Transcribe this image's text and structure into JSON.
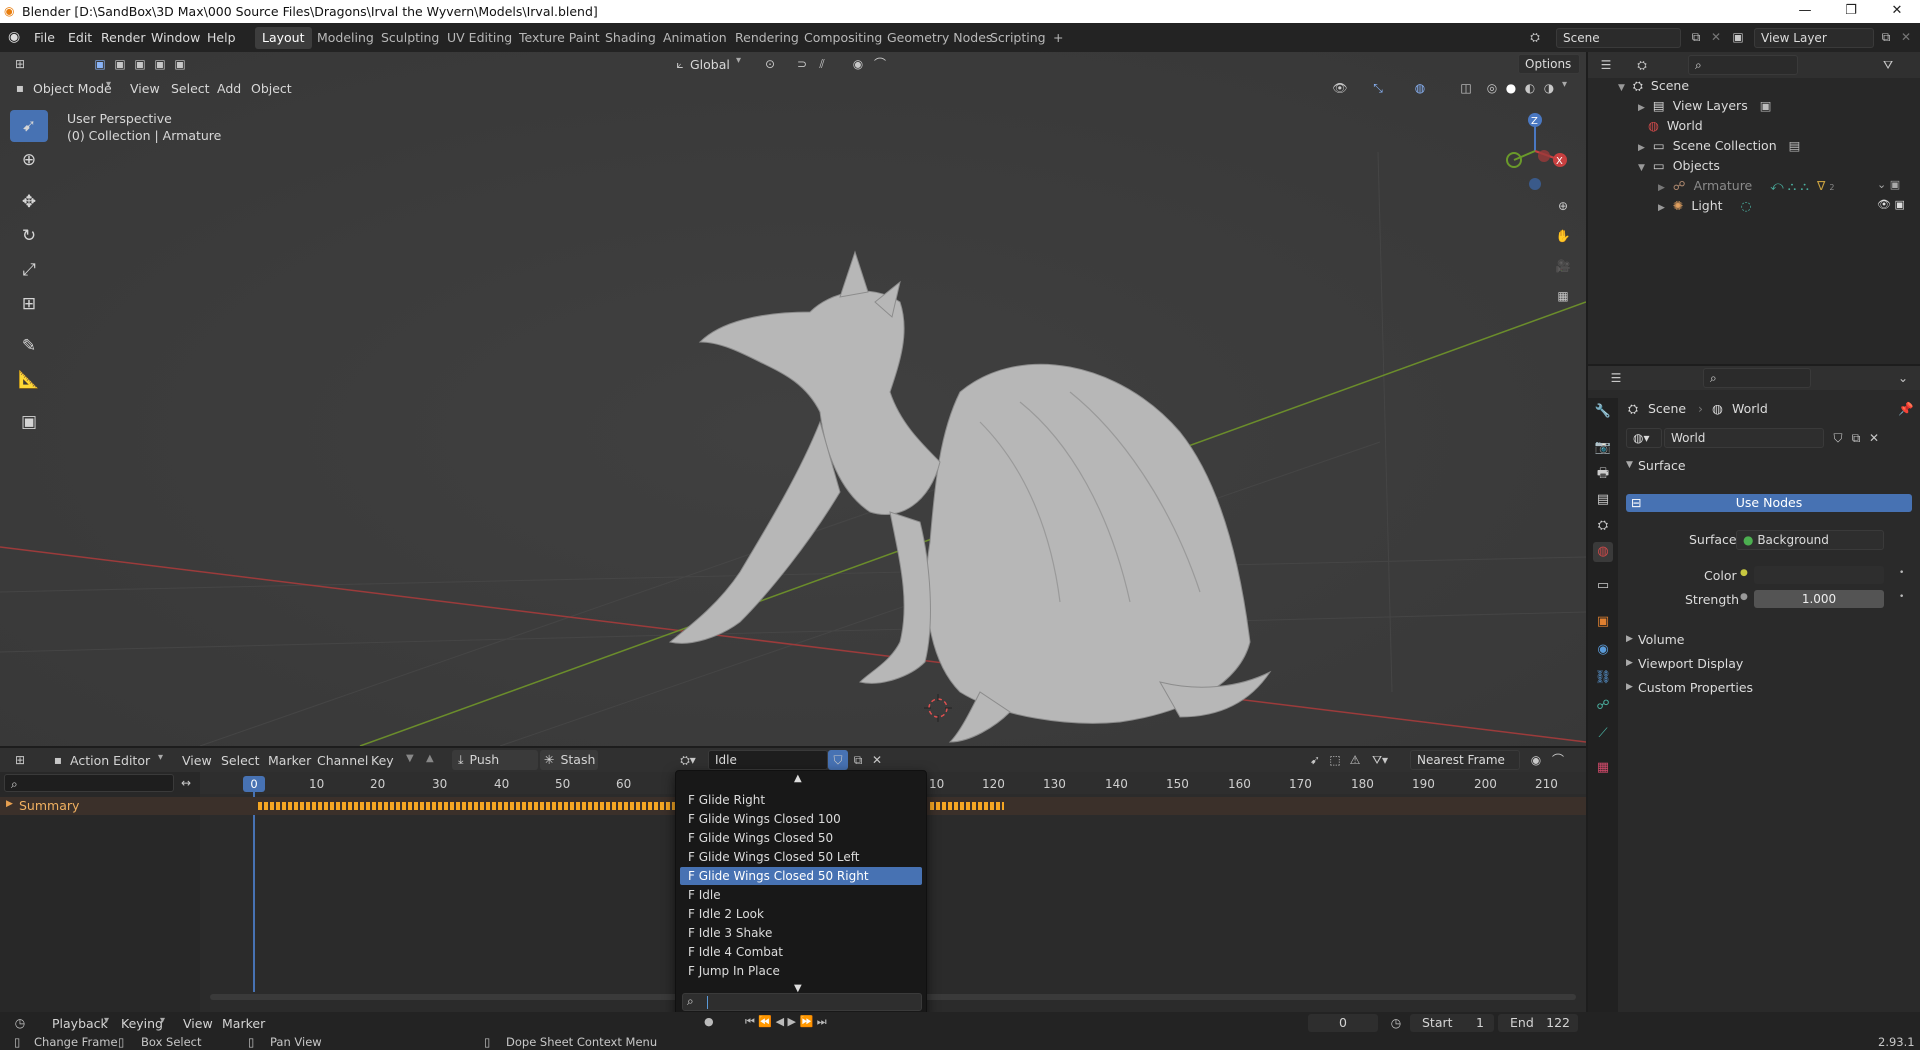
{
  "window": {
    "title": "Blender [D:\\SandBox\\3D Max\\000 Source Files\\Dragons\\Irval the Wyvern\\Models\\Irval.blend]",
    "minimize": "—",
    "maximize": "❐",
    "close": "✕"
  },
  "menubar": {
    "items": [
      "File",
      "Edit",
      "Render",
      "Window",
      "Help"
    ],
    "workspaces": [
      "Layout",
      "Modeling",
      "Sculpting",
      "UV Editing",
      "Texture Paint",
      "Shading",
      "Animation",
      "Rendering",
      "Compositing",
      "Geometry Nodes",
      "Scripting"
    ],
    "add_workspace": "+",
    "scene": "Scene",
    "view_layer": "View Layer"
  },
  "viewport": {
    "mode": "Object Mode",
    "menus": [
      "View",
      "Select",
      "Add",
      "Object"
    ],
    "transform_orientation": "Global",
    "options": "Options",
    "info_line1": "User Perspective",
    "info_line2": "(0) Collection | Armature",
    "gizmo": {
      "z": "Z",
      "x": "X"
    },
    "colors": {
      "background": "#3d3d3d",
      "x_axis": "#a03a3a",
      "y_axis": "#6a8a2a",
      "mesh": "#b5b5b5"
    }
  },
  "outliner": {
    "rows": [
      {
        "label": "Scene",
        "icon": "scene-icon"
      },
      {
        "label": "View Layers",
        "icon": "view-layers-icon"
      },
      {
        "label": "World",
        "icon": "world-icon"
      },
      {
        "label": "Scene Collection",
        "icon": "collection-icon"
      },
      {
        "label": "Objects",
        "icon": "objects-icon"
      },
      {
        "label": "Armature",
        "icon": "armature-icon"
      },
      {
        "label": "Light",
        "icon": "light-icon"
      }
    ],
    "armature_badge": "2"
  },
  "properties": {
    "breadcrumb_scene": "Scene",
    "breadcrumb_world": "World",
    "world_name": "World",
    "surface_panel": "Surface",
    "use_nodes": "Use Nodes",
    "surface_label": "Surface",
    "surface_value": "Background",
    "color_label": "Color",
    "strength_label": "Strength",
    "strength_value": "1.000",
    "volume_panel": "Volume",
    "viewport_display_panel": "Viewport Display",
    "custom_properties_panel": "Custom Properties"
  },
  "action_editor": {
    "editor_type": "Action Editor",
    "menus": [
      "View",
      "Select",
      "Marker",
      "Channel",
      "Key"
    ],
    "push_down": "Push Down",
    "stash": "Stash",
    "action_name": "Idle",
    "snapping": "Nearest Frame",
    "summary": "Summary",
    "current_frame": "0",
    "ticks": [
      "10",
      "20",
      "30",
      "40",
      "50",
      "60",
      "10",
      "120",
      "130",
      "140",
      "150",
      "160",
      "170",
      "180",
      "190",
      "200",
      "210"
    ]
  },
  "dropdown": {
    "items": [
      "F Glide Right",
      "F Glide Wings Closed 100",
      "F Glide Wings Closed 50",
      "F Glide Wings Closed 50 Left",
      "F Glide Wings Closed 50 Right",
      "F Idle",
      "F Idle 2 Look",
      "F Idle 3 Shake",
      "F Idle 4 Combat",
      "F Jump In Place"
    ],
    "selected_index": 4,
    "search_placeholder": ""
  },
  "timeline": {
    "menus": [
      "Playback",
      "Keying",
      "View",
      "Marker"
    ],
    "frame": "0",
    "start_label": "Start",
    "start_value": "1",
    "end_label": "End",
    "end_value": "122"
  },
  "statusbar": {
    "change_frame": "Change Frame",
    "box_select": "Box Select",
    "pan_view": "Pan View",
    "context_menu": "Dope Sheet Context Menu",
    "version": "2.93.1"
  }
}
